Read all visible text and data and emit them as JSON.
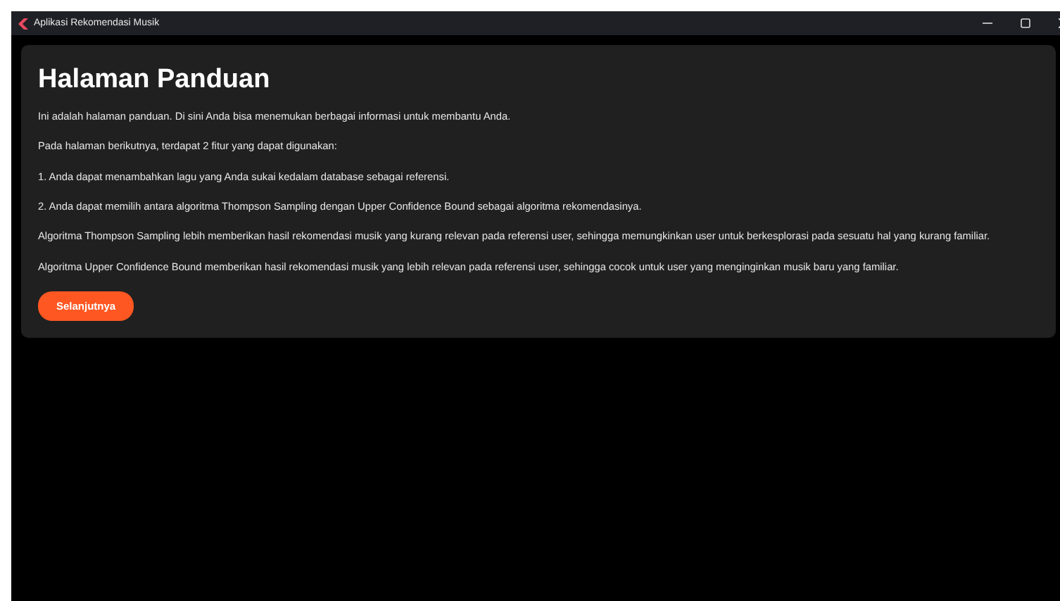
{
  "window": {
    "title": "Aplikasi Rekomendasi Musik"
  },
  "page": {
    "heading": "Halaman Panduan",
    "paragraphs": [
      "Ini adalah halaman panduan. Di sini Anda bisa menemukan berbagai informasi untuk membantu Anda.",
      "Pada halaman berikutnya, terdapat 2 fitur yang dapat digunakan:",
      "1. Anda dapat menambahkan lagu yang Anda sukai kedalam database sebagai referensi.",
      "2. Anda dapat memilih antara algoritma Thompson Sampling dengan Upper Confidence Bound sebagai algoritma rekomendasinya.",
      "Algoritma Thompson Sampling lebih memberikan hasil rekomendasi musik yang kurang relevan pada referensi user, sehingga memungkinkan user untuk berkesplorasi pada sesuatu hal yang kurang familiar.",
      "Algoritma Upper Confidence Bound memberikan hasil rekomendasi musik yang lebih relevan pada referensi user, sehingga cocok untuk user yang menginginkan musik baru yang familiar."
    ],
    "button": "Selanjutnya"
  }
}
